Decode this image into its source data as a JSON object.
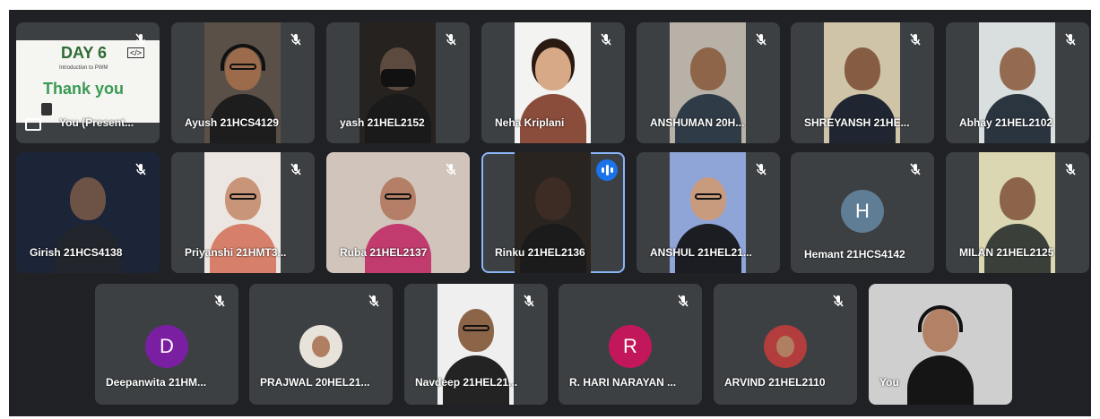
{
  "slide": {
    "title": "DAY 6",
    "code_badge": "</>",
    "subtitle": "Introduction to PWM",
    "thanks": "Thank you"
  },
  "participants": [
    {
      "name": "You (Present...",
      "row": 0,
      "col": 0,
      "type": "presentation",
      "muted": true
    },
    {
      "name": "Ayush 21HCS4129",
      "row": 0,
      "col": 1,
      "type": "video",
      "muted": true,
      "bg": "#5a5048",
      "skin": "#9b6b4c",
      "shirt": "#1d1d1d",
      "glasses": true,
      "headphones": true
    },
    {
      "name": "yash 21HEL2152",
      "row": 0,
      "col": 2,
      "type": "video",
      "muted": true,
      "bg": "#26221f",
      "skin": "#5c4a3f",
      "shirt": "#1a1a1a",
      "mask": true
    },
    {
      "name": "Neha Kriplani",
      "row": 0,
      "col": 3,
      "type": "video",
      "muted": true,
      "bg": "#f3f3f1",
      "skin": "#d7a986",
      "shirt": "#8a4c3b",
      "hair": "#2a1a12"
    },
    {
      "name": "ANSHUMAN 20H...",
      "row": 0,
      "col": 4,
      "type": "video",
      "muted": true,
      "bg": "#b7b1a7",
      "skin": "#8e6548",
      "shirt": "#2f3b46"
    },
    {
      "name": "SHREYANSH 21HE...",
      "row": 0,
      "col": 5,
      "type": "video",
      "muted": true,
      "bg": "#cfc3a8",
      "skin": "#865c42",
      "shirt": "#1f2631"
    },
    {
      "name": "Abhay 21HEL2102",
      "row": 0,
      "col": 6,
      "type": "video",
      "muted": true,
      "bg": "#d9dede",
      "skin": "#946b50",
      "shirt": "#2b3540"
    },
    {
      "name": "Girish 21HCS4138",
      "row": 1,
      "col": 0,
      "type": "video",
      "muted": true,
      "bg": "#1c2438",
      "skin": "#6d5346",
      "shirt": "#22262c",
      "wide": true
    },
    {
      "name": "Priyanshi 21HMT3...",
      "row": 1,
      "col": 1,
      "type": "video",
      "muted": true,
      "bg": "#ece6e2",
      "skin": "#c99579",
      "shirt": "#d6806b",
      "glasses": true
    },
    {
      "name": "Ruba 21HEL2137",
      "row": 1,
      "col": 2,
      "type": "video",
      "muted": true,
      "bg": "#d1c5bb",
      "skin": "#b47f66",
      "shirt": "#c23b6e",
      "glasses": true,
      "wide": true
    },
    {
      "name": "Rinku 21HEL2136",
      "row": 1,
      "col": 3,
      "type": "video",
      "muted": false,
      "speaking": true,
      "bg": "#2a2420",
      "skin": "#3d2c24",
      "shirt": "#1b1b1b"
    },
    {
      "name": "ANSHUL 21HEL21...",
      "row": 1,
      "col": 4,
      "type": "video",
      "muted": true,
      "bg": "#8fa5d8",
      "skin": "#c89b7f",
      "shirt": "#1c1d22",
      "glasses": true
    },
    {
      "name": "Hemant 21HCS4142",
      "row": 1,
      "col": 5,
      "type": "avatar",
      "muted": true,
      "initial": "H",
      "color": "#5f7d95"
    },
    {
      "name": "MILAN 21HEL2125",
      "row": 1,
      "col": 6,
      "type": "video",
      "muted": true,
      "bg": "#dbd7b2",
      "skin": "#8b6449",
      "shirt": "#3a3f3a"
    },
    {
      "name": "Deepanwita 21HM...",
      "row": 2,
      "col": 0,
      "type": "avatar",
      "muted": true,
      "initial": "D",
      "color": "#7b1fa2"
    },
    {
      "name": "PRAJWAL 20HEL21...",
      "row": 2,
      "col": 1,
      "type": "photo-avatar",
      "muted": true,
      "color": "#e8e3da"
    },
    {
      "name": "Navdeep 21HEL21...",
      "row": 2,
      "col": 2,
      "type": "video",
      "muted": true,
      "bg": "#efefef",
      "skin": "#8c6448",
      "shirt": "#232323",
      "glasses": true
    },
    {
      "name": "R. HARI NARAYAN ...",
      "row": 2,
      "col": 3,
      "type": "avatar",
      "muted": true,
      "initial": "R",
      "color": "#c2185b"
    },
    {
      "name": "ARVIND 21HEL2110",
      "row": 2,
      "col": 4,
      "type": "photo-avatar",
      "muted": true,
      "color": "#b33c3c"
    },
    {
      "name": "You",
      "row": 2,
      "col": 5,
      "type": "video",
      "muted": false,
      "bg": "#cfcfcf",
      "skin": "#b38266",
      "shirt": "#151515",
      "wide": true,
      "headphones": true
    }
  ]
}
